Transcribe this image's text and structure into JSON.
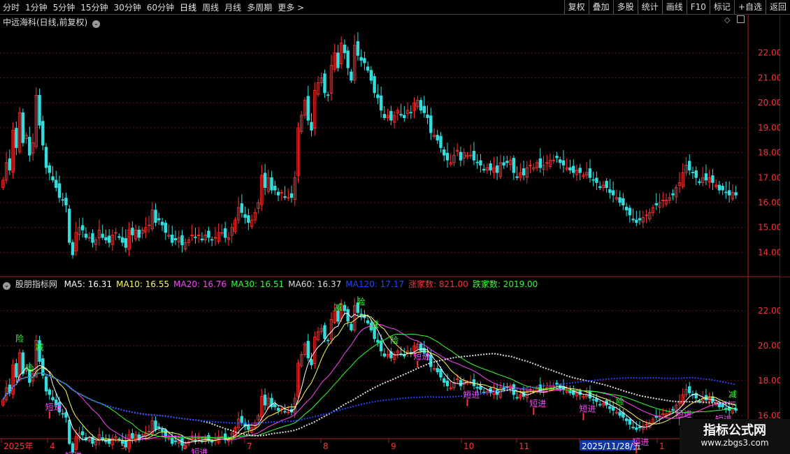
{
  "toolbar": {
    "periods": [
      "分时",
      "1分钟",
      "5分钟",
      "15分钟",
      "30分钟",
      "60分钟",
      "日线",
      "周线",
      "月线",
      "多周期",
      "更多 >"
    ],
    "active_period": "日线",
    "buttons": [
      "复权",
      "叠加",
      "多股",
      "统计",
      "画线",
      "F10",
      "标记",
      "+自选",
      "返回"
    ]
  },
  "main_panel": {
    "title": "中远海科(日线,前复权)",
    "title_chevron_icon": "chevron-down-icon",
    "y_ticks": [
      "22.00",
      "21.00",
      "20.00",
      "19.00",
      "18.00",
      "17.00",
      "16.00",
      "15.00",
      "14.00"
    ]
  },
  "indicator_panel": {
    "name": "股朋指标网",
    "ma_legend": [
      {
        "label": "MA5: 16.31",
        "color": "#ffffff"
      },
      {
        "label": "MA10: 16.55",
        "color": "#ffff55"
      },
      {
        "label": "MA20: 16.76",
        "color": "#ff44ff"
      },
      {
        "label": "MA30: 16.51",
        "color": "#33ff33"
      },
      {
        "label": "MA60: 16.37",
        "color": "#dddddd"
      },
      {
        "label": "MA120: 17.17",
        "color": "#2244ff"
      },
      {
        "label": "涨家数: 821.00",
        "color": "#ff3333"
      },
      {
        "label": "跌家数: 2019.00",
        "color": "#33ff33"
      }
    ],
    "y_ticks": [
      "22.00",
      "20.00",
      "18.00",
      "16.00"
    ],
    "markers": [
      {
        "text": "险",
        "color": "#33ff33"
      },
      {
        "text": "减",
        "color": "#33ff33"
      },
      {
        "text": "短进",
        "color": "#ff44ff"
      },
      {
        "text": "险",
        "color": "#33ff33"
      },
      {
        "text": "短进",
        "color": "#ff44ff"
      },
      {
        "text": "险",
        "color": "#33ff33"
      },
      {
        "text": "险",
        "color": "#33ff33"
      },
      {
        "text": "减",
        "color": "#33ff33"
      },
      {
        "text": "减",
        "color": "#33ff33"
      },
      {
        "text": "短进",
        "color": "#ff44ff"
      },
      {
        "text": "短进",
        "color": "#ff44ff"
      },
      {
        "text": "短进",
        "color": "#ff44ff"
      },
      {
        "text": "短进",
        "color": "#ff44ff"
      },
      {
        "text": "险",
        "color": "#33ff33"
      },
      {
        "text": "短进",
        "color": "#ff44ff"
      },
      {
        "text": "短进",
        "color": "#ff44ff"
      },
      {
        "text": "短进",
        "color": "#ff44ff"
      },
      {
        "text": "减",
        "color": "#33ff33"
      },
      {
        "text": "短进",
        "color": "#ff44ff"
      }
    ]
  },
  "x_axis": {
    "labels": [
      "2025年",
      "4",
      "5",
      "6",
      "7",
      "8",
      "9",
      "10",
      "11",
      "2025/11/28/五",
      "1"
    ]
  },
  "watermark": {
    "title": "指标公式网",
    "url": "www.zbgs3.com"
  },
  "colors": {
    "up": "#ff3333",
    "down": "#33dddd",
    "grid": "#661111",
    "axis": "#aa2222",
    "label": "#ff3333"
  },
  "chart_data": {
    "type": "candlestick",
    "price_range": [
      13.2,
      23.0
    ],
    "indicator_range": [
      14.8,
      23.0
    ],
    "closes": [
      16.9,
      17.6,
      17.3,
      18.9,
      18.2,
      19.6,
      18.4,
      18.7,
      17.9,
      18.4,
      20.3,
      19.1,
      18.3,
      17.4,
      17.2,
      16.9,
      16.6,
      16.2,
      16.1,
      15.9,
      14.4,
      13.9,
      14.8,
      15.0,
      14.9,
      14.6,
      14.6,
      14.4,
      14.5,
      14.9,
      14.6,
      14.5,
      14.4,
      14.7,
      14.8,
      14.6,
      14.4,
      14.2,
      14.9,
      14.7,
      14.9,
      14.6,
      14.9,
      15.0,
      15.1,
      15.7,
      15.2,
      15.3,
      15.1,
      14.8,
      14.7,
      14.4,
      14.5,
      14.6,
      14.3,
      14.4,
      14.5,
      14.7,
      14.6,
      14.7,
      14.5,
      14.7,
      14.6,
      14.5,
      14.6,
      14.8,
      14.8,
      14.6,
      14.6,
      15.0,
      15.3,
      15.8,
      15.6,
      15.4,
      15.2,
      15.3,
      15.6,
      16.0,
      17.1,
      16.6,
      17.0,
      16.5,
      16.5,
      16.3,
      16.4,
      16.2,
      16.2,
      16.2,
      17.0,
      19.0,
      19.5,
      20.1,
      19.3,
      18.9,
      20.5,
      20.8,
      21.0,
      20.4,
      20.3,
      21.5,
      22.0,
      21.4,
      22.4,
      22.0,
      21.4,
      20.9,
      22.3,
      21.9,
      21.7,
      21.6,
      21.3,
      20.9,
      20.4,
      20.2,
      19.7,
      19.4,
      19.5,
      19.3,
      19.5,
      19.7,
      19.5,
      19.4,
      19.7,
      19.6,
      20.0,
      20.1,
      19.7,
      19.6,
      19.4,
      18.8,
      18.7,
      18.5,
      18.2,
      17.9,
      17.7,
      17.6,
      17.9,
      18.1,
      17.7,
      18.0,
      17.9,
      17.9,
      17.7,
      17.6,
      17.5,
      17.3,
      17.4,
      17.3,
      17.4,
      17.2,
      17.6,
      17.5,
      17.6,
      17.7,
      17.2,
      17.0,
      17.2,
      17.1,
      17.4,
      17.5,
      17.4,
      17.6,
      17.4,
      17.5,
      17.6,
      17.7,
      17.7,
      17.8,
      17.6,
      17.5,
      17.4,
      17.3,
      17.2,
      17.3,
      17.2,
      17.1,
      17.2,
      17.0,
      16.9,
      16.8,
      16.6,
      16.7,
      16.6,
      16.4,
      16.3,
      16.2,
      16.0,
      15.9,
      15.7,
      15.5,
      15.3,
      15.2,
      15.3,
      15.4,
      15.5,
      15.6,
      15.8,
      15.9,
      16.0,
      16.1,
      16.1,
      16.2,
      16.3,
      16.6,
      16.8,
      17.2,
      17.5,
      17.3,
      17.2,
      17.0,
      16.8,
      17.0,
      16.9,
      17.0,
      16.8,
      16.7,
      16.5,
      16.5,
      16.4,
      16.3,
      16.4,
      16.3
    ]
  }
}
